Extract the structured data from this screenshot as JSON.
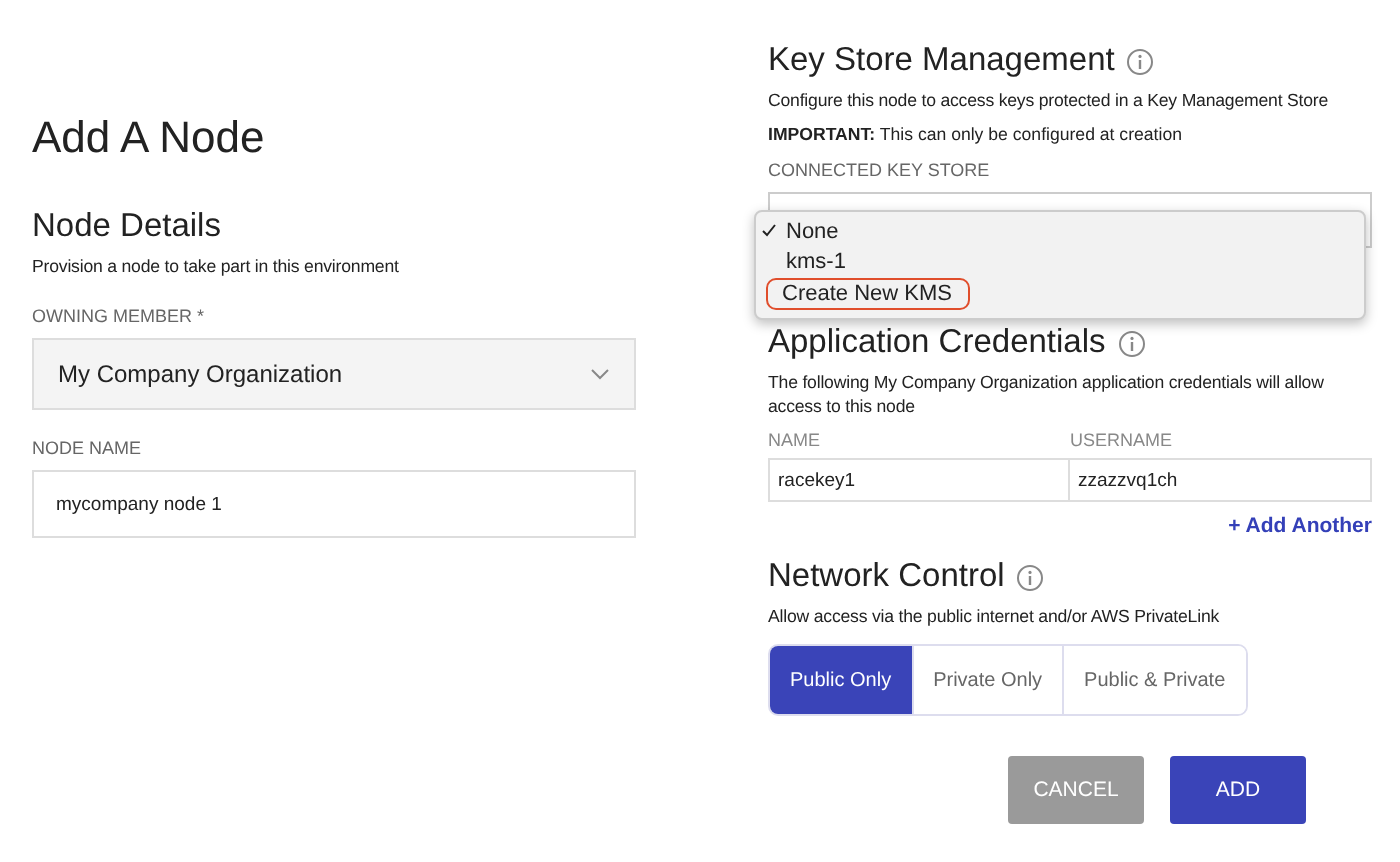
{
  "left": {
    "title": "Add A Node",
    "section_title": "Node Details",
    "description": "Provision a node to take part in this environment",
    "owning_member": {
      "label": "OWNING MEMBER *",
      "value": "My Company Organization"
    },
    "node_name": {
      "label": "NODE NAME",
      "value": "mycompany node 1"
    }
  },
  "key_store": {
    "title": "Key Store Management",
    "description": "Configure this node to access keys protected in a Key Management Store",
    "important": "**IMPORTANT:** This can only be configured at creation",
    "label": "CONNECTED KEY STORE",
    "menu": [
      {
        "label": "None",
        "selected": true,
        "focused": false
      },
      {
        "label": "kms-1",
        "selected": false,
        "focused": false
      },
      {
        "label": "Create New KMS",
        "selected": false,
        "focused": true
      }
    ]
  },
  "credentials": {
    "title": "Application Credentials",
    "description": "The following My Company Organization application credentials will allow access to this node",
    "columns": [
      "NAME",
      "USERNAME"
    ],
    "rows": [
      [
        "racekey1",
        "zzazzvq1ch"
      ]
    ],
    "add_link": "+ Add Another"
  },
  "network": {
    "title": "Network Control",
    "description": "Allow access via the public internet and/or AWS PrivateLink",
    "options": [
      {
        "label": "Public Only",
        "selected": true
      },
      {
        "label": "Private Only",
        "selected": false
      },
      {
        "label": "Public & Private",
        "selected": false
      }
    ]
  },
  "buttons": [
    {
      "label": "CANCEL",
      "kind": "secondary"
    },
    {
      "label": "ADD",
      "kind": "primary"
    }
  ]
}
